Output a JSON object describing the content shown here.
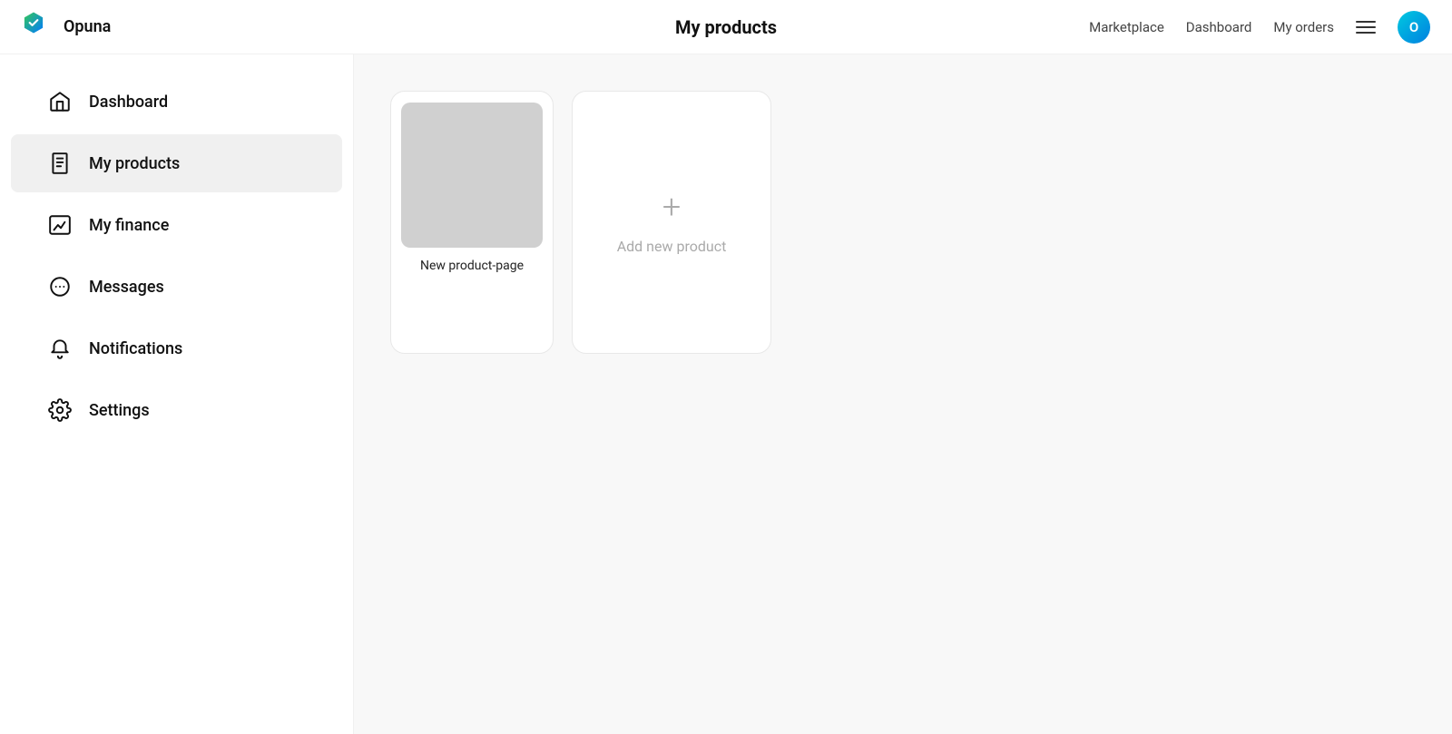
{
  "brand": {
    "name": "Opuna"
  },
  "header": {
    "page_title": "My products",
    "nav_links": [
      {
        "label": "Marketplace",
        "id": "marketplace"
      },
      {
        "label": "Dashboard",
        "id": "dashboard"
      },
      {
        "label": "My orders",
        "id": "my-orders"
      }
    ],
    "avatar_letter": "O"
  },
  "sidebar": {
    "items": [
      {
        "id": "dashboard",
        "label": "Dashboard",
        "icon": "home-icon"
      },
      {
        "id": "my-products",
        "label": "My products",
        "icon": "products-icon",
        "active": true
      },
      {
        "id": "my-finance",
        "label": "My finance",
        "icon": "finance-icon"
      },
      {
        "id": "messages",
        "label": "Messages",
        "icon": "messages-icon"
      },
      {
        "id": "notifications",
        "label": "Notifications",
        "icon": "notifications-icon"
      },
      {
        "id": "settings",
        "label": "Settings",
        "icon": "settings-icon"
      }
    ]
  },
  "main": {
    "products": [
      {
        "id": "product-1",
        "name": "New product-page"
      }
    ],
    "add_product_label": "Add new product"
  }
}
